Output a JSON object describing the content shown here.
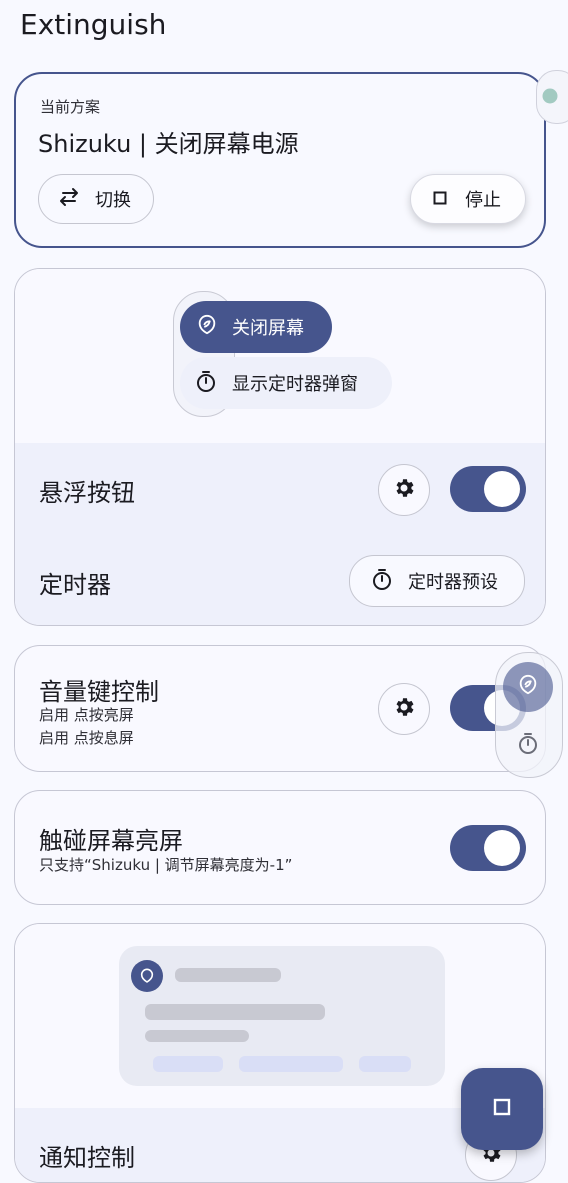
{
  "app": {
    "title": "Extinguish"
  },
  "scheme": {
    "label": "当前方案",
    "value": "Shizuku | 关闭屏幕电源",
    "switch_label": "切换",
    "stop_label": "停止"
  },
  "floating_preview": {
    "close_screen_label": "关闭屏幕",
    "show_timer_label": "显示定时器弹窗"
  },
  "floating_button": {
    "title": "悬浮按钮",
    "enabled": true
  },
  "timer": {
    "title": "定时器",
    "preset_label": "定时器预设"
  },
  "volume_control": {
    "title": "音量键控制",
    "line1": "启用 点按亮屏",
    "line2": "启用 点按息屏",
    "enabled": true
  },
  "touch_wake": {
    "title": "触碰屏幕亮屏",
    "subtitle": "只支持“Shizuku | 调节屏幕亮度为-1”",
    "enabled": true
  },
  "notification_control": {
    "title": "通知控制"
  },
  "colors": {
    "primary": "#46558d",
    "background": "#f8f9ff",
    "outline": "#c5c6d0"
  },
  "icons": {
    "switch": "swap-arrows-icon",
    "stop": "square-stop-icon",
    "app": "leaf-shield-icon",
    "timer": "stopwatch-icon",
    "settings": "gear-icon"
  }
}
